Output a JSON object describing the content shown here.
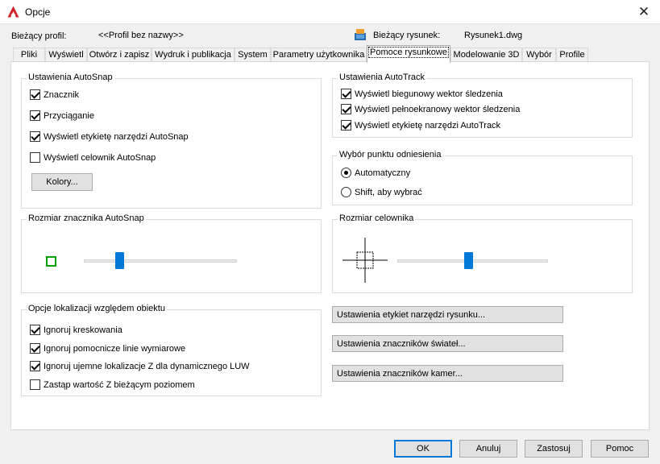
{
  "window": {
    "title": "Opcje",
    "close_glyph": "✕"
  },
  "header": {
    "profile_label": "Bieżący profil:",
    "profile_value": "<<Profil bez nazwy>>",
    "drawing_label": "Bieżący rysunek:",
    "drawing_value": "Rysunek1.dwg"
  },
  "tabs": [
    {
      "label": "Pliki",
      "active": false
    },
    {
      "label": "Wyświetl",
      "active": false
    },
    {
      "label": "Otwórz i zapisz",
      "active": false
    },
    {
      "label": "Wydruk i publikacja",
      "active": false
    },
    {
      "label": "System",
      "active": false
    },
    {
      "label": "Parametry użytkownika",
      "active": false
    },
    {
      "label": "Pomoce rysunkowe",
      "active": true
    },
    {
      "label": "Modelowanie 3D",
      "active": false
    },
    {
      "label": "Wybór",
      "active": false
    },
    {
      "label": "Profile",
      "active": false
    }
  ],
  "autosnap": {
    "title": "Ustawienia AutoSnap",
    "items": [
      {
        "label": "Znacznik",
        "checked": true
      },
      {
        "label": "Przyciąganie",
        "checked": true
      },
      {
        "label": "Wyświetl etykietę narzędzi AutoSnap",
        "checked": true
      },
      {
        "label": "Wyświetl celownik AutoSnap",
        "checked": false
      }
    ],
    "colors_button": "Kolory..."
  },
  "autotrack": {
    "title": "Ustawienia AutoTrack",
    "items": [
      {
        "label": "Wyświetl biegunowy wektor śledzenia",
        "checked": true
      },
      {
        "label": "Wyświetl pełnoekranowy wektor śledzenia",
        "checked": true
      },
      {
        "label": "Wyświetl etykietę narzędzi AutoTrack",
        "checked": true
      }
    ]
  },
  "refpoint": {
    "title": "Wybór punktu odniesienia",
    "options": [
      {
        "label": "Automatyczny",
        "selected": true
      },
      {
        "label": "Shift, aby wybrać",
        "selected": false
      }
    ]
  },
  "marker_size": {
    "title": "Rozmiar znacznika AutoSnap",
    "value": 0.22,
    "marker_color": "#00a000"
  },
  "aperture_size": {
    "title": "Rozmiar celownika",
    "value": 0.47
  },
  "object_snap": {
    "title": "Opcje lokalizacji względem obiektu",
    "items": [
      {
        "label": "Ignoruj kreskowania",
        "checked": true
      },
      {
        "label": "Ignoruj pomocnicze linie wymiarowe",
        "checked": true
      },
      {
        "label": "Ignoruj ujemne lokalizacje Z dla dynamicznego LUW",
        "checked": true
      },
      {
        "label": "Zastąp wartość Z bieżącym poziomem",
        "checked": false
      }
    ]
  },
  "settings_buttons": {
    "tooltip": "Ustawienia etykiet narzędzi rysunku...",
    "lights": "Ustawienia znaczników świateł...",
    "cameras": "Ustawienia znaczników kamer..."
  },
  "footer": {
    "ok": "OK",
    "cancel": "Anuluj",
    "apply": "Zastosuj",
    "help": "Pomoc"
  },
  "colors": {
    "accent": "#0078d7",
    "autocad_red": "#d3202a"
  }
}
